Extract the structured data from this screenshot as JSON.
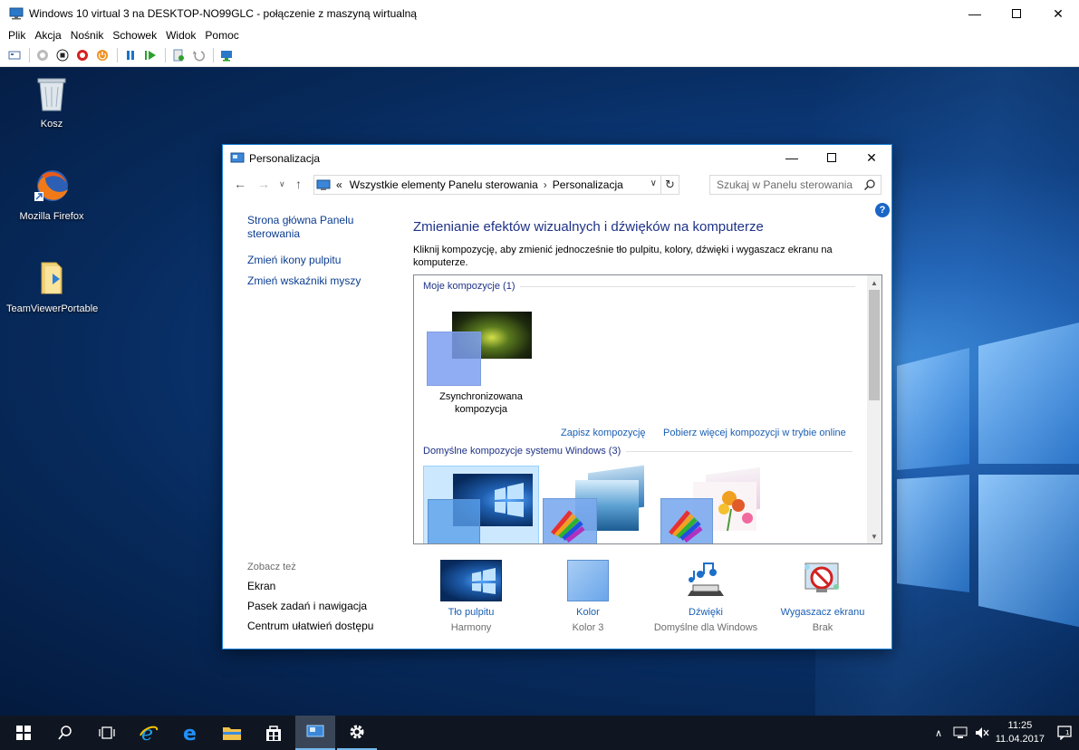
{
  "vm": {
    "title": "Windows 10 virtual 3 na DESKTOP-NO99GLC - połączenie z maszyną wirtualną",
    "menu": [
      "Plik",
      "Akcja",
      "Nośnik",
      "Schowek",
      "Widok",
      "Pomoc"
    ]
  },
  "desktop": {
    "icons": [
      {
        "label": "Kosz"
      },
      {
        "label": "Mozilla Firefox"
      },
      {
        "label": "TeamViewerPortable"
      }
    ]
  },
  "personalization": {
    "window_title": "Personalizacja",
    "breadcrumb": {
      "prefix": "«",
      "part1": "Wszystkie elementy Panelu sterowania",
      "part2": "Personalizacja"
    },
    "search_placeholder": "Szukaj w Panelu sterowania",
    "left_nav": [
      "Strona główna Panelu sterowania",
      "Zmień ikony pulpitu",
      "Zmień wskaźniki myszy"
    ],
    "see_also_heading": "Zobacz też",
    "see_also": [
      "Ekran",
      "Pasek zadań i nawigacja",
      "Centrum ułatwień dostępu"
    ],
    "heading": "Zmienianie efektów wizualnych i dźwięków na komputerze",
    "subtitle": "Kliknij kompozycję, aby zmienić jednocześnie tło pulpitu, kolory, dźwięki i wygaszacz ekranu na komputerze.",
    "my_themes_heading": "Moje kompozycje (1)",
    "synced_theme": "Zsynchronizowana kompozycja",
    "save_theme": "Zapisz kompozycję",
    "get_more": "Pobierz więcej kompozycji w trybie online",
    "default_themes_heading": "Domyślne kompozycje systemu Windows (3)",
    "bottom": [
      {
        "label": "Tło pulpitu",
        "sub": "Harmony"
      },
      {
        "label": "Kolor",
        "sub": "Kolor 3"
      },
      {
        "label": "Dźwięki",
        "sub": "Domyślne dla Windows"
      },
      {
        "label": "Wygaszacz ekranu",
        "sub": "Brak"
      }
    ]
  },
  "taskbar": {
    "time": "11:25",
    "date": "11.04.2017"
  }
}
